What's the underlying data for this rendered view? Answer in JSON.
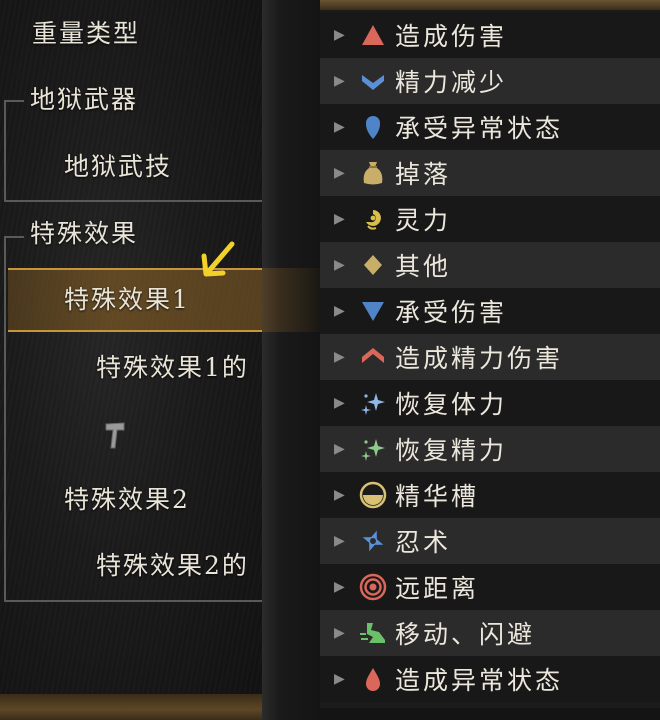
{
  "tree": {
    "items": [
      {
        "label": "重量类型"
      },
      {
        "label": "地狱武器"
      },
      {
        "label": "地狱武技"
      },
      {
        "label": "特殊效果"
      },
      {
        "label": "特殊效果1"
      },
      {
        "label": "特殊效果1的"
      },
      {
        "label": "特殊效果2"
      },
      {
        "label": "特殊效果2的"
      }
    ],
    "selected_index": 4,
    "hammer_icon": "hammer-icon",
    "pointer_icon": "yellow-arrow-icon"
  },
  "categories": [
    {
      "label": "造成伤害",
      "icon": "triangle-up-icon",
      "color": "#d9675a"
    },
    {
      "label": "精力减少",
      "icon": "chevron-down-icon",
      "color": "#5b8fd6"
    },
    {
      "label": "承受异常状态",
      "icon": "drop-icon",
      "color": "#4f84c9"
    },
    {
      "label": "掉落",
      "icon": "bag-icon",
      "color": "#c9ae6a"
    },
    {
      "label": "灵力",
      "icon": "spirit-icon",
      "color": "#d9c04a"
    },
    {
      "label": "其他",
      "icon": "diamond-icon",
      "color": "#c9ae6a"
    },
    {
      "label": "承受伤害",
      "icon": "triangle-down-icon",
      "color": "#4f84c9"
    },
    {
      "label": "造成精力伤害",
      "icon": "chevron-up-icon",
      "color": "#d9675a"
    },
    {
      "label": "恢复体力",
      "icon": "sparkle-blue-icon",
      "color": "#8fb8e6"
    },
    {
      "label": "恢复精力",
      "icon": "sparkle-green-icon",
      "color": "#8fc98a"
    },
    {
      "label": "精华槽",
      "icon": "essence-slot-icon",
      "color": "#d8c074"
    },
    {
      "label": "忍术",
      "icon": "shuriken-icon",
      "color": "#5b8fd6"
    },
    {
      "label": "远距离",
      "icon": "target-icon",
      "color": "#d9675a"
    },
    {
      "label": "移动、闪避",
      "icon": "dash-icon",
      "color": "#6cc06a"
    },
    {
      "label": "造成异常状态",
      "icon": "blood-drop-icon",
      "color": "#d9675a"
    }
  ]
}
